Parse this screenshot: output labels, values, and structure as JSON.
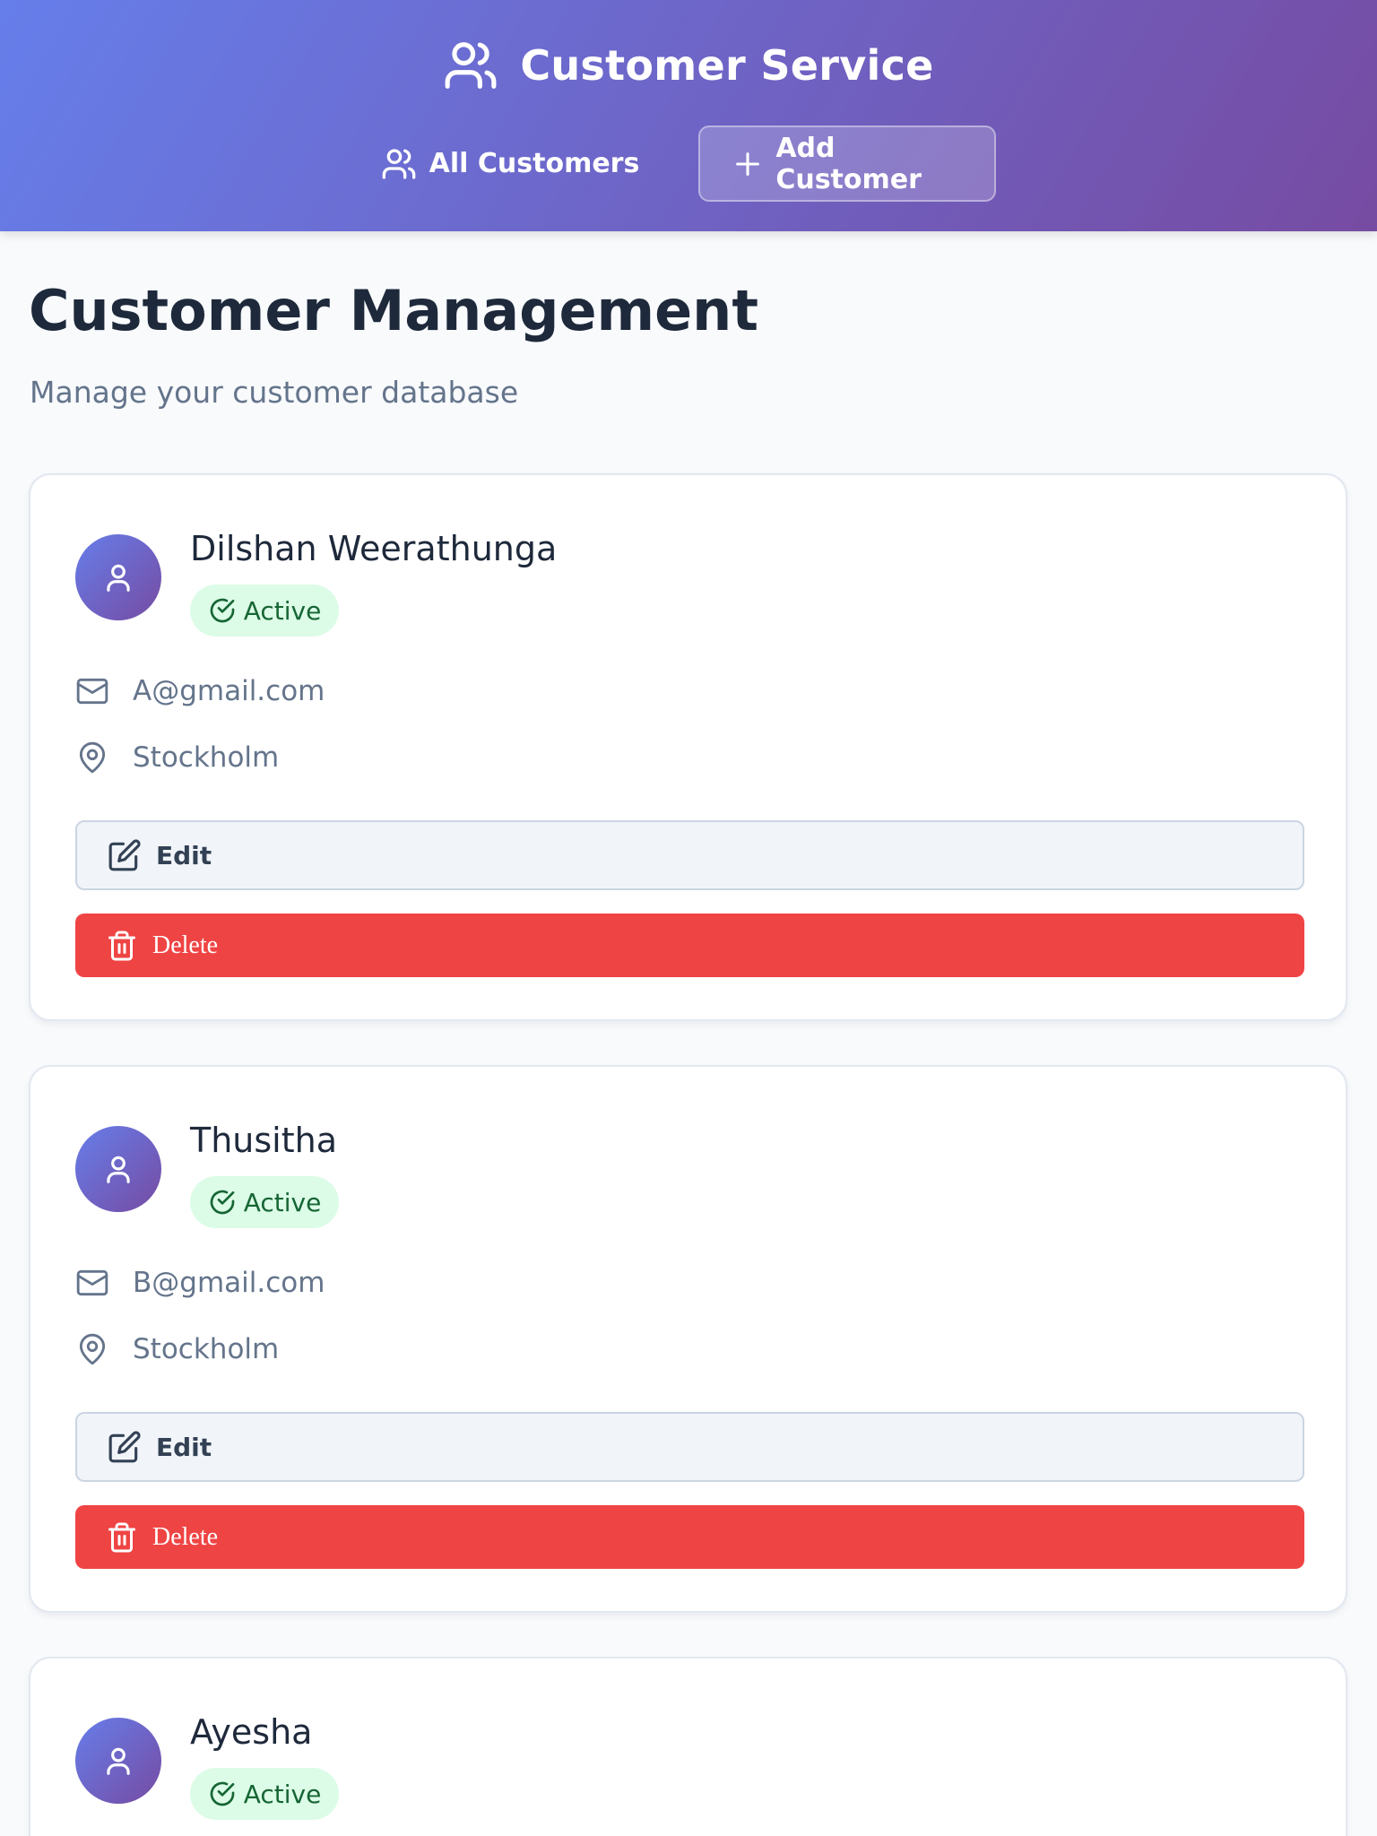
{
  "header": {
    "title": "Customer Service",
    "title_icon": "users-icon",
    "nav": [
      {
        "label": "All Customers",
        "icon": "users-icon"
      },
      {
        "label": "Add Customer",
        "icon": "plus-icon"
      }
    ]
  },
  "page": {
    "title": "Customer Management",
    "subtitle": "Manage your customer database"
  },
  "customers": [
    {
      "name": "Dilshan Weerathunga",
      "status": "Active",
      "email": "A@gmail.com",
      "city": "Stockholm",
      "edit_label": "Edit",
      "delete_label": "Delete"
    },
    {
      "name": "Thusitha",
      "status": "Active",
      "email": "B@gmail.com",
      "city": "Stockholm",
      "edit_label": "Edit",
      "delete_label": "Delete"
    },
    {
      "name": "Ayesha",
      "status": "Active"
    }
  ],
  "colors": {
    "header_gradient_start": "#667eea",
    "header_gradient_end": "#764ba2",
    "delete": "#ef4444",
    "badge_bg": "#dcfce7",
    "badge_text": "#166534"
  }
}
